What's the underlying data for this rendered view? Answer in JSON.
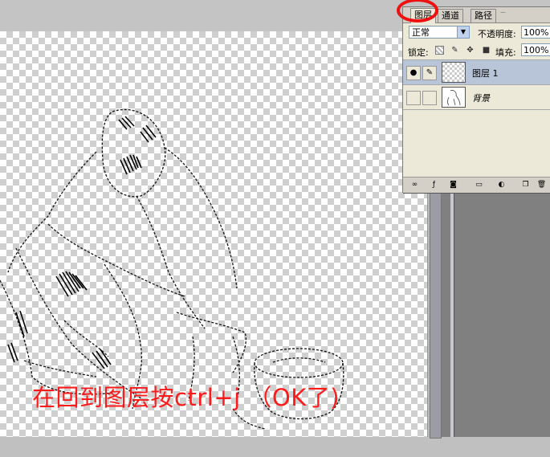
{
  "panel": {
    "tabs": [
      {
        "label": "图层",
        "active": true
      },
      {
        "label": "通道",
        "active": false
      },
      {
        "label": "路径",
        "active": false
      }
    ],
    "blend_mode": "正常",
    "opacity_label": "不透明度:",
    "opacity_value": "100%",
    "lock_label": "锁定:",
    "fill_label": "填充:",
    "fill_value": "100%",
    "layers": [
      {
        "name": "图层 1",
        "selected": true,
        "visible": true
      },
      {
        "name": "背景",
        "selected": false,
        "visible": false
      }
    ]
  },
  "icons": {
    "eye": "eye-icon",
    "brush": "brush-icon",
    "lock_transparent": "lock-transparent-icon",
    "lock_paint": "paint-brush-icon",
    "lock_move": "move-icon",
    "lock_all": "lock-icon",
    "bottom": [
      "link-icon",
      "fx-icon",
      "mask-icon",
      "folder-icon",
      "adjustment-icon",
      "new-layer-icon",
      "trash-icon"
    ]
  },
  "annotation": {
    "text": "在回到图层按ctrl+j （OK了)",
    "color": "#ff1a1a",
    "circle_color": "#ee1111"
  },
  "colors": {
    "selected_layer": "#b8c4d8",
    "panel_bg": "#ece9d8"
  }
}
